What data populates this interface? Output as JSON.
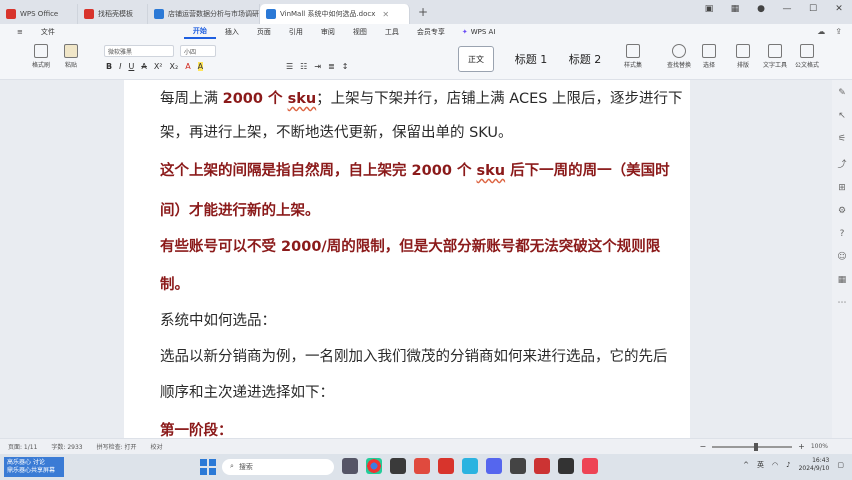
{
  "titlebar": {
    "tabs": [
      {
        "label": "WPS Office",
        "color": "#d8342c",
        "active": false
      },
      {
        "label": "找稻壳模板",
        "color": "#d8342c",
        "active": false
      },
      {
        "label": "店铺运营数据分析与市场调研",
        "color": "#2b79d6",
        "active": false
      },
      {
        "label": "VinMall 系统中如何选品.docx",
        "color": "#2b79d6",
        "active": true
      }
    ],
    "new_tab": "+"
  },
  "ribbon_tabs": [
    "开始",
    "插入",
    "页面",
    "引用",
    "审阅",
    "视图",
    "工具",
    "会员专享"
  ],
  "ribbon_active": "开始",
  "wps_ai": "WPS AI",
  "toolbar": {
    "format_painter": "格式刷",
    "paste": "粘贴",
    "font_name": "微软雅黑",
    "font_size": "小四",
    "styles": {
      "normal": "正文",
      "h1": "标题 1",
      "h2": "标题 2"
    },
    "right_labels": [
      "样式集",
      "查找替换",
      "选择",
      "排版",
      "文字工具",
      "公文格式"
    ]
  },
  "document": {
    "paragraphs": [
      {
        "segments": [
          {
            "text": "每周上满 ",
            "bold": false
          },
          {
            "text": "2000 个 ",
            "bold": true,
            "red": true
          },
          {
            "text": "sku",
            "bold": true,
            "red": true,
            "wave": true
          },
          {
            "text": "；上架与下架并行，店铺上满 ACES 上限后，逐步进行下",
            "bold": false
          }
        ]
      },
      {
        "segments": [
          {
            "text": "架，再进行上架，不断地迭代更新，保留出单的 SKU。",
            "bold": false
          }
        ]
      },
      {
        "red": true,
        "segments": [
          {
            "text": "这个上架的间隔是指自然周，自上架完 2000 个 ",
            "bold": true
          },
          {
            "text": "sku",
            "bold": true,
            "wave": true
          },
          {
            "text": " 后下一周的周一（美国时",
            "bold": true
          }
        ]
      },
      {
        "red": true,
        "segments": [
          {
            "text": "间）才能进行新的上架。",
            "bold": true
          }
        ]
      },
      {
        "red": true,
        "segments": [
          {
            "text": "有些账号可以不受 2000/周的限制，但是大部分新账号都无法突破这个规则限",
            "bold": true
          }
        ]
      },
      {
        "red": true,
        "segments": [
          {
            "text": "制。",
            "bold": true
          }
        ]
      },
      {
        "segments": [
          {
            "text": "系统中如何选品：",
            "bold": false
          }
        ]
      },
      {
        "segments": [
          {
            "text": "选品以新分销商为例，一名刚加入我们微茂的分销商如何来进行选品，它的先后",
            "bold": false
          }
        ]
      },
      {
        "segments": [
          {
            "text": "顺序和主次递进选择如下：",
            "bold": false
          }
        ]
      },
      {
        "red": true,
        "segments": [
          {
            "text": "第一阶段：",
            "bold": true
          }
        ]
      }
    ]
  },
  "statusbar": {
    "page": "页面: 1/11",
    "words": "字数: 2933",
    "spell": "拼写检查: 打开",
    "proof": "校对",
    "zoom": "100%"
  },
  "taskbar": {
    "weather_line1": "高乐器心 讨论",
    "weather_line2": "鼎乐器心共享屏幕",
    "search": "搜索",
    "tray_lang": "英",
    "time": "16:43",
    "date": "2024/9/10"
  },
  "colors": {
    "accent": "#1f5fe0",
    "red_text": "#8b1a1a"
  }
}
